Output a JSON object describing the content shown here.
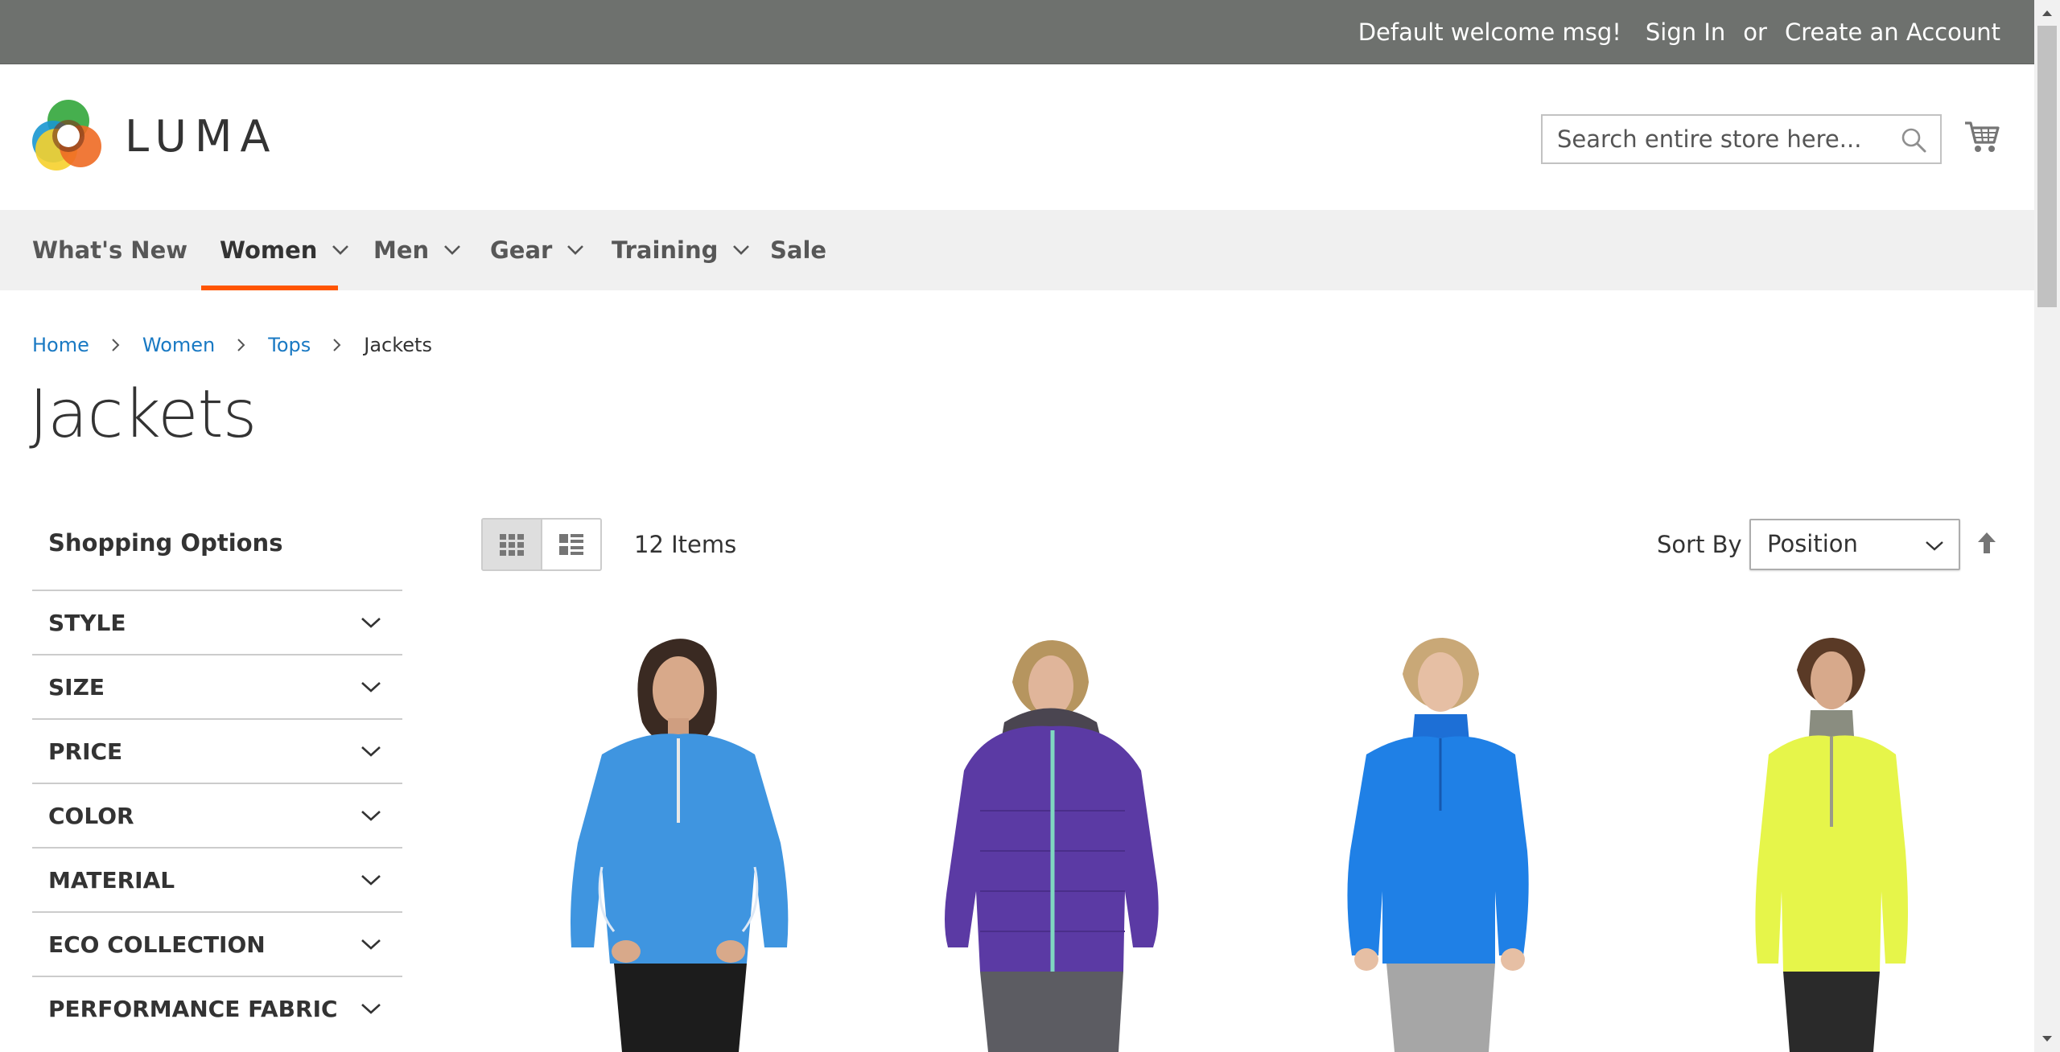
{
  "top_panel": {
    "welcome": "Default welcome msg!",
    "sign_in": "Sign In",
    "or": "or",
    "create_account": "Create an Account"
  },
  "header": {
    "logo_text": "LUMA",
    "search_placeholder": "Search entire store here...",
    "search_value": "",
    "icons": {
      "search": "search-icon",
      "cart": "cart-icon"
    }
  },
  "nav": {
    "items": [
      {
        "label": "What's New",
        "has_dropdown": false,
        "active": false
      },
      {
        "label": "Women",
        "has_dropdown": true,
        "active": true
      },
      {
        "label": "Men",
        "has_dropdown": true,
        "active": false
      },
      {
        "label": "Gear",
        "has_dropdown": true,
        "active": false
      },
      {
        "label": "Training",
        "has_dropdown": true,
        "active": false
      },
      {
        "label": "Sale",
        "has_dropdown": false,
        "active": false
      }
    ],
    "active_color": "#ff5501"
  },
  "breadcrumbs": {
    "items": [
      "Home",
      "Women",
      "Tops"
    ],
    "current": "Jackets"
  },
  "page_title": "Jackets",
  "sidebar": {
    "title": "Shopping Options",
    "filters": [
      "STYLE",
      "SIZE",
      "PRICE",
      "COLOR",
      "MATERIAL",
      "ECO COLLECTION",
      "PERFORMANCE FABRIC"
    ]
  },
  "toolbar": {
    "view_modes": [
      "grid",
      "list"
    ],
    "active_mode": "grid",
    "amount": "12 Items",
    "sort_label": "Sort By",
    "sort_value": "Position",
    "sort_direction_icon": "arrow-up-icon"
  },
  "products": [
    {
      "image": "woman-light-blue-quarter-zip-jacket"
    },
    {
      "image": "woman-purple-puffer-jacket"
    },
    {
      "image": "woman-blue-pullover-jacket"
    },
    {
      "image": "woman-yellow-quarter-zip-jacket"
    }
  ],
  "colors": {
    "top_panel_bg": "#6e716e",
    "nav_bg": "#f0f0f0",
    "link": "#1979c3",
    "accent": "#ff5501"
  }
}
